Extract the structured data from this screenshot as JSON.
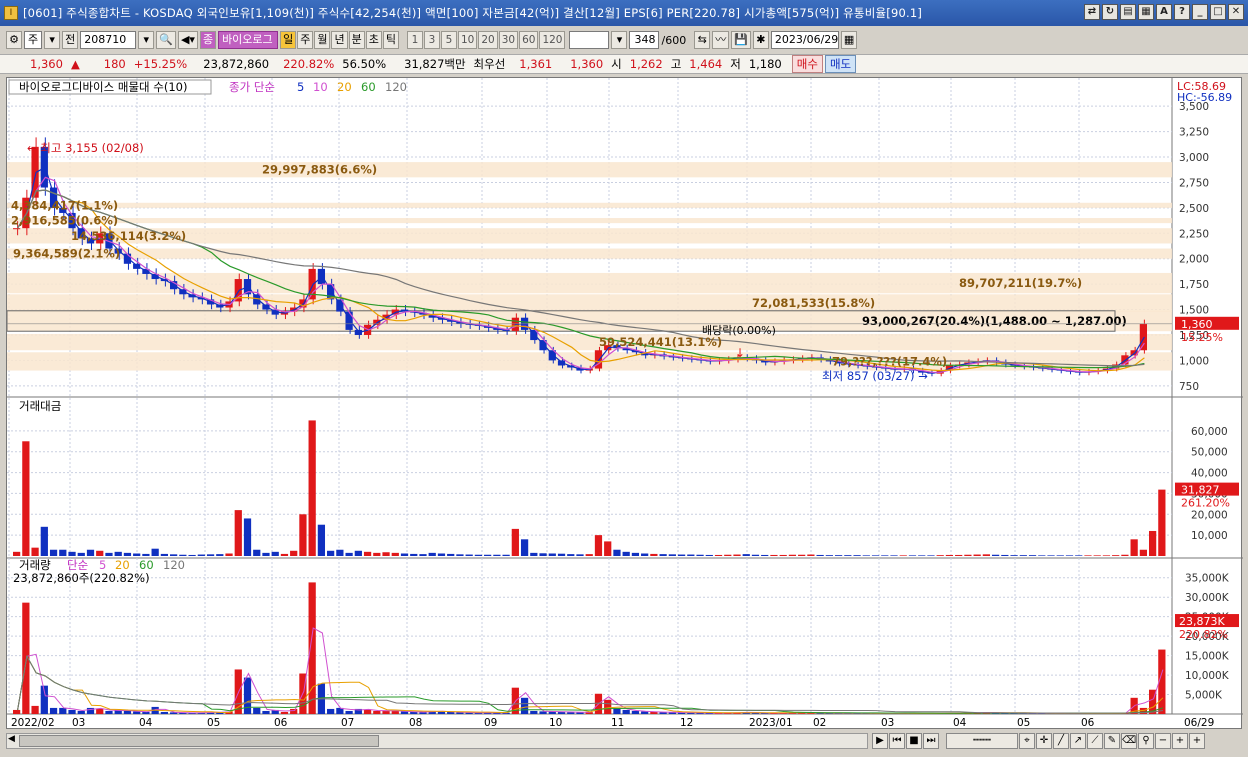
{
  "window": {
    "title": "[0601] 주식종합차트 - KOSDAQ 외국인보유[1,109(천)] 주식수[42,254(천)] 액면[100] 자본금[42(억)] 결산[12월] EPS[6] PER[220.78] 시가총액[575(억)] 유통비율[90.1]",
    "app_icon": "I"
  },
  "toolbar": {
    "type_select": "주",
    "all_label": "전",
    "code": "208710",
    "stock_name": "바이오로그",
    "period_buttons": [
      "일",
      "주",
      "월",
      "년",
      "분",
      "초",
      "틱"
    ],
    "active_period": "일",
    "interval_buttons": [
      "1",
      "3",
      "5",
      "10",
      "20",
      "30",
      "60",
      "120"
    ],
    "count_value": "348",
    "count_max": "/600",
    "date": "2023/06/29",
    "stock_badge": "종"
  },
  "quote": {
    "price": "1,360",
    "arrow": "▲",
    "change": "180",
    "change_pct": "+15.25%",
    "volume": "23,872,860",
    "volume_ratio": "220.82%",
    "turnover": "56.50%",
    "amount": "31,827백만",
    "priority_label": "최우선",
    "ask": "1,361",
    "bid": "1,360",
    "open_label": "시",
    "open": "1,262",
    "high_label": "고",
    "high": "1,464",
    "low_label": "저",
    "low": "1,180",
    "buy_button": "매수",
    "sell_button": "매도"
  },
  "chart_data": [
    {
      "type": "candlestick",
      "title": "바이오로그디바이스 매물대 수(10)",
      "ma_label": "종가 단순",
      "ma_periods": [
        "5",
        "10",
        "20",
        "60",
        "120"
      ],
      "ma_colors": [
        "#1030c0",
        "#d050d0",
        "#e8a000",
        "#2a9a2a",
        "#777777"
      ],
      "y_ticks": [
        "3,500",
        "3,250",
        "3,000",
        "2,750",
        "2,500",
        "2,250",
        "2,000",
        "1,750",
        "1,500",
        "1,250",
        "1,000",
        "750"
      ],
      "ylim": [
        650,
        3600
      ],
      "lc": "LC:58.69",
      "hc": "HC:-56.89",
      "last_price": "1,360",
      "last_pct": "15.25%",
      "high_note": "최고 3,155 (02/08)",
      "low_note": "최저 857 (03/27)",
      "dividend_note": "배당락(0.00%)",
      "volume_profile": [
        {
          "label": "29,997,883(6.6%)",
          "from": 2800,
          "to": 2950
        },
        {
          "label": "4,384,417(1.1%)",
          "from": 2500,
          "to": 2550
        },
        {
          "label": "2,916,585(0.6%)",
          "from": 2350,
          "to": 2400
        },
        {
          "label": "14,536,114(3.2%)",
          "from": 2150,
          "to": 2300
        },
        {
          "label": "9,364,589(2.1%)",
          "from": 2000,
          "to": 2100
        },
        {
          "label": "89,707,211(19.7%)",
          "from": 1660,
          "to": 1860
        },
        {
          "label": "72,081,533(15.8%)",
          "from": 1480,
          "to": 1650
        },
        {
          "label": "93,000,267(20.4%)(1,488.00 ~ 1,287.00)",
          "from": 1287,
          "to": 1488
        },
        {
          "label": "59,524,441(13.1%)",
          "from": 1100,
          "to": 1260
        },
        {
          "label": "79,???,???(17.4%)",
          "from": 900,
          "to": 1080
        }
      ],
      "closes": [
        2300,
        2600,
        3100,
        2700,
        2500,
        2450,
        2300,
        2200,
        2150,
        2250,
        2100,
        2050,
        1950,
        1900,
        1850,
        1800,
        1780,
        1700,
        1650,
        1620,
        1600,
        1550,
        1520,
        1580,
        1800,
        1650,
        1550,
        1500,
        1450,
        1480,
        1520,
        1600,
        1900,
        1750,
        1600,
        1480,
        1300,
        1250,
        1350,
        1400,
        1450,
        1500,
        1480,
        1470,
        1450,
        1420,
        1400,
        1380,
        1360,
        1350,
        1340,
        1320,
        1300,
        1290,
        1420,
        1300,
        1200,
        1100,
        1000,
        950,
        930,
        900,
        920,
        1100,
        1150,
        1120,
        1100,
        1080,
        1050,
        1060,
        1040,
        1030,
        1020,
        1010,
        1000,
        990,
        1000,
        1010,
        1030,
        1020,
        1000,
        980,
        990,
        1000,
        1010,
        1020,
        1030,
        1010,
        990,
        970,
        960,
        950,
        940,
        930,
        920,
        910,
        920,
        900,
        880,
        870,
        900,
        950,
        960,
        980,
        990,
        1000,
        980,
        960,
        950,
        940,
        930,
        920,
        910,
        900,
        890,
        880,
        890,
        900,
        920,
        960,
        1050,
        1100,
        1360
      ],
      "x_ticks": [
        "2022/02",
        "03",
        "04",
        "05",
        "06",
        "07",
        "08",
        "09",
        "10",
        "11",
        "12",
        "2023/01",
        "02",
        "03",
        "04",
        "05",
        "06",
        "06/29"
      ]
    },
    {
      "type": "bar",
      "title": "거래대금",
      "y_ticks": [
        "60,000",
        "50,000",
        "40,000",
        "30,000",
        "20,000",
        "10,000"
      ],
      "ylim": [
        0,
        70000
      ],
      "last_value": "31,827",
      "last_pct": "261.20%",
      "values": [
        2000,
        55000,
        4000,
        14000,
        3000,
        3000,
        2000,
        1500,
        3000,
        2500,
        1500,
        2000,
        1500,
        1200,
        1000,
        3500,
        1000,
        800,
        600,
        500,
        700,
        800,
        900,
        1200,
        22000,
        18000,
        3000,
        1500,
        2000,
        1000,
        2500,
        20000,
        65000,
        15000,
        2500,
        3000,
        1500,
        2500,
        2000,
        1500,
        1800,
        1500,
        1200,
        1000,
        900,
        1500,
        1200,
        1000,
        800,
        700,
        600,
        600,
        600,
        600,
        13000,
        8000,
        1500,
        1300,
        1200,
        1100,
        900,
        800,
        900,
        10000,
        7000,
        3000,
        2000,
        1500,
        1200,
        1000,
        900,
        800,
        700,
        700,
        600,
        500,
        500,
        600,
        700,
        900,
        600,
        500,
        500,
        500,
        600,
        600,
        700,
        500,
        400,
        400,
        400,
        400,
        300,
        300,
        300,
        300,
        300,
        300,
        300,
        300,
        400,
        500,
        500,
        600,
        700,
        800,
        600,
        500,
        400,
        400,
        400,
        300,
        300,
        300,
        300,
        300,
        300,
        300,
        300,
        400,
        600,
        8000,
        3000,
        12000,
        31827
      ],
      "colors_note": "red=up, blue=down"
    },
    {
      "type": "bar",
      "title": "거래량",
      "ma_label": "단순",
      "ma_periods": [
        "5",
        "20",
        "60",
        "120"
      ],
      "ma_colors": [
        "#d050d0",
        "#e8a000",
        "#2a9a2a",
        "#777777"
      ],
      "sub_label": "23,872,860주(220.82%)",
      "y_ticks": [
        "35,000K",
        "30,000K",
        "25,000K",
        "20,000K",
        "15,000K",
        "10,000K",
        "5,000K"
      ],
      "ylim": [
        0,
        37500000
      ],
      "last_value": "23,873K",
      "last_pct": "220.82%",
      "volume_scale": 0.52
    }
  ],
  "bottom": {
    "nav_icons": [
      "play-icon",
      "first-icon",
      "stop-icon",
      "last-icon"
    ],
    "zoom_minus": "−",
    "zoom_plus": "+",
    "zoom_fit": "+"
  }
}
